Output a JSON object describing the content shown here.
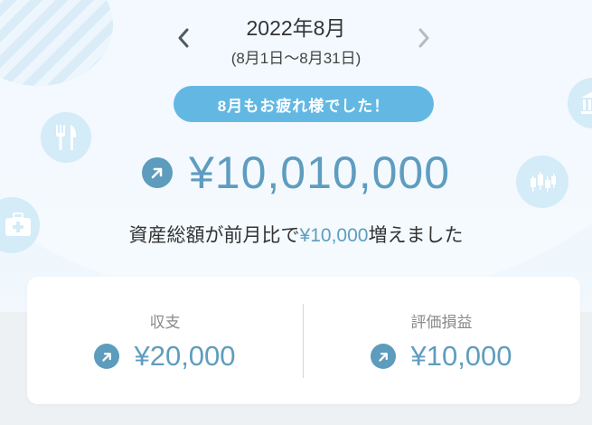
{
  "header": {
    "title": "2022年8月",
    "date_range": "(8月1日〜8月31日)",
    "prev_icon": "chevron-left-icon",
    "next_icon": "chevron-right-icon"
  },
  "message_pill": "8月もお疲れ様でした！",
  "total": {
    "icon": "arrow-up-right-icon",
    "amount": "¥10,010,000"
  },
  "summary": {
    "prefix": "資産総額が前月比で",
    "delta": "¥10,000",
    "suffix": "増えました"
  },
  "metrics": [
    {
      "label": "収支",
      "value": "¥20,000",
      "icon": "arrow-up-right-icon"
    },
    {
      "label": "評価損益",
      "value": "¥10,000",
      "icon": "arrow-up-right-icon"
    }
  ],
  "decorations": [
    "fork-knife-icon",
    "bank-icon",
    "medical-kit-icon",
    "stock-chart-icon"
  ],
  "colors": {
    "accent": "#5e9dbf",
    "pill": "#63b8e3",
    "deco": "#d4ebf8"
  }
}
